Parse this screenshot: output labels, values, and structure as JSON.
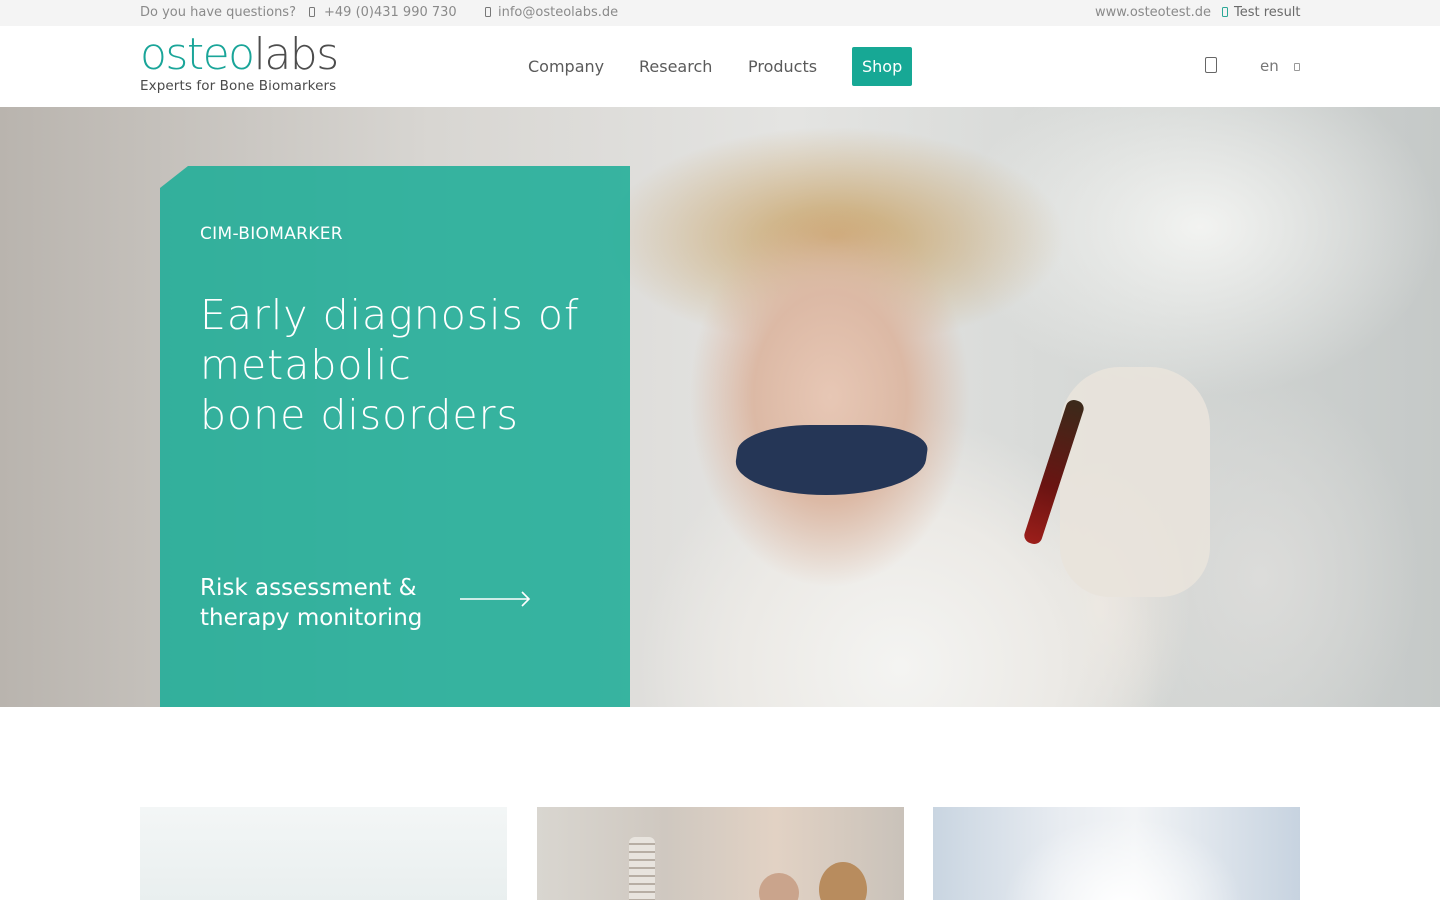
{
  "topbar": {
    "question": "Do you have questions?",
    "phone": "+49 (0)431 990 730",
    "email": "info@osteolabs.de",
    "site": "www.osteotest.de",
    "test_result": "Test result"
  },
  "header": {
    "logo_part1": "osteo",
    "logo_part2": "labs",
    "tagline": "Experts for Bone Biomarkers",
    "nav": {
      "company": "Company",
      "research": "Research",
      "products": "Products",
      "shop": "Shop"
    },
    "language": "en"
  },
  "hero": {
    "eyebrow": "CIM-BIOMARKER",
    "title_lines": [
      "Early diagnosis of",
      "metabolic",
      "bone disorders"
    ],
    "link_lines": [
      "Risk assessment &",
      "therapy monitoring"
    ]
  },
  "colors": {
    "brand": "#1aa599",
    "panel": "#1bac96",
    "topbar_bg": "#f4f4f4"
  },
  "icons": [
    "phone-icon",
    "mail-icon",
    "lock-icon",
    "search-icon",
    "chevron-down-icon",
    "arrow-right-icon"
  ]
}
